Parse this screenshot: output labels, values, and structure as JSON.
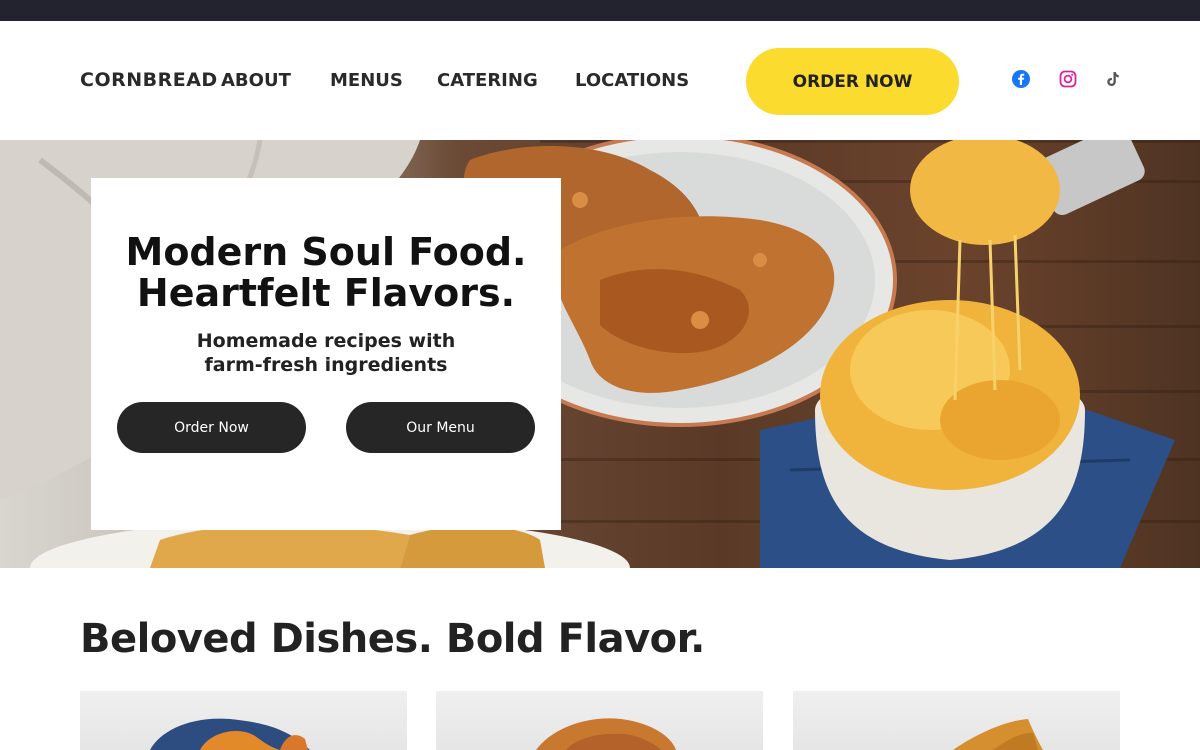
{
  "header": {
    "logo_text": "CORNBREAD",
    "nav": [
      {
        "label": "ABOUT"
      },
      {
        "label": "MENUS"
      },
      {
        "label": "CATERING"
      },
      {
        "label": "LOCATIONS"
      }
    ],
    "order_button": "ORDER NOW",
    "social_icons": [
      "facebook-icon",
      "instagram-icon",
      "tiktok-icon"
    ]
  },
  "hero": {
    "title_line1": "Modern Soul Food.",
    "title_line2": "Heartfelt Flavors.",
    "subtitle_line1": "Homemade recipes with",
    "subtitle_line2": "farm-fresh ingredients",
    "primary_button": "Order Now",
    "secondary_button": "Our Menu"
  },
  "section": {
    "title": "Beloved Dishes. Bold Flavor."
  },
  "colors": {
    "accent": "#fcdb2f",
    "topbar": "#22232f",
    "button_dark": "#262626",
    "facebook": "#1877f2",
    "instagram": "#d6249f",
    "tiktok": "#555555"
  }
}
